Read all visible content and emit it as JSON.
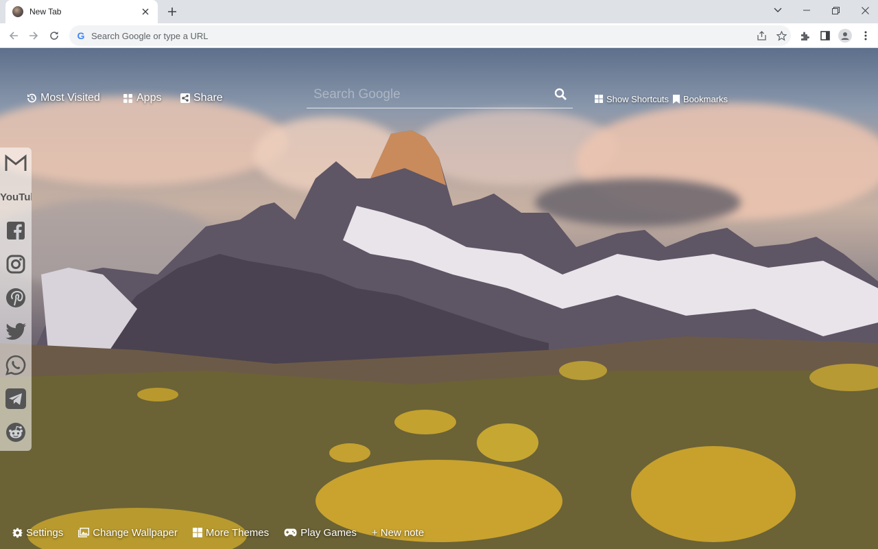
{
  "browser": {
    "tab_title": "New Tab",
    "omnibox_placeholder": "Search Google or type a URL",
    "google_g": "G"
  },
  "ntp": {
    "top_links": {
      "most_visited": "Most Visited",
      "apps": "Apps",
      "share": "Share",
      "show_shortcuts": "Show Shortcuts",
      "bookmarks": "Bookmarks"
    },
    "search": {
      "placeholder": "Search Google"
    },
    "social": [
      {
        "name": "gmail-icon"
      },
      {
        "name": "youtube-icon",
        "text": "YouTube"
      },
      {
        "name": "facebook-icon"
      },
      {
        "name": "instagram-icon"
      },
      {
        "name": "pinterest-icon"
      },
      {
        "name": "twitter-icon"
      },
      {
        "name": "whatsapp-icon"
      },
      {
        "name": "telegram-icon"
      },
      {
        "name": "reddit-icon"
      }
    ],
    "bottom_links": {
      "settings": "Settings",
      "change_wallpaper": "Change Wallpaper",
      "more_themes": "More Themes",
      "play_games": "Play Games",
      "new_note": "+ New note"
    }
  }
}
